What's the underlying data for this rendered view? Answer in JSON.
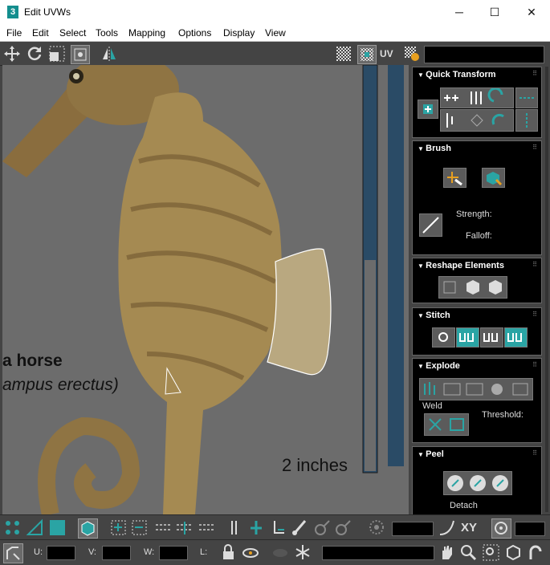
{
  "window": {
    "title": "Edit UVWs",
    "app_icon_label": "3",
    "minimize": "─",
    "maximize": "☐",
    "close": "✕"
  },
  "menu": [
    "File",
    "Edit",
    "Select",
    "Tools",
    "Mapping",
    "Options",
    "Display",
    "View"
  ],
  "toolbar_top": {
    "uv_label": "UV"
  },
  "viewport": {
    "caption_title": "a horse",
    "caption_species": "ampus erectus)",
    "scale_label": "2 inches"
  },
  "panels": {
    "quick_transform": {
      "title": "Quick Transform"
    },
    "brush": {
      "title": "Brush",
      "strength_label": "Strength:",
      "falloff_label": "Falloff:"
    },
    "reshape": {
      "title": "Reshape Elements"
    },
    "stitch": {
      "title": "Stitch"
    },
    "explode": {
      "title": "Explode",
      "weld_label": "Weld",
      "threshold_label": "Threshold:"
    },
    "peel": {
      "title": "Peel",
      "detach_label": "Detach"
    }
  },
  "bottom": {
    "xy_label": "XY",
    "u_label": "U:",
    "v_label": "V:",
    "w_label": "W:",
    "l_label": "L:"
  }
}
